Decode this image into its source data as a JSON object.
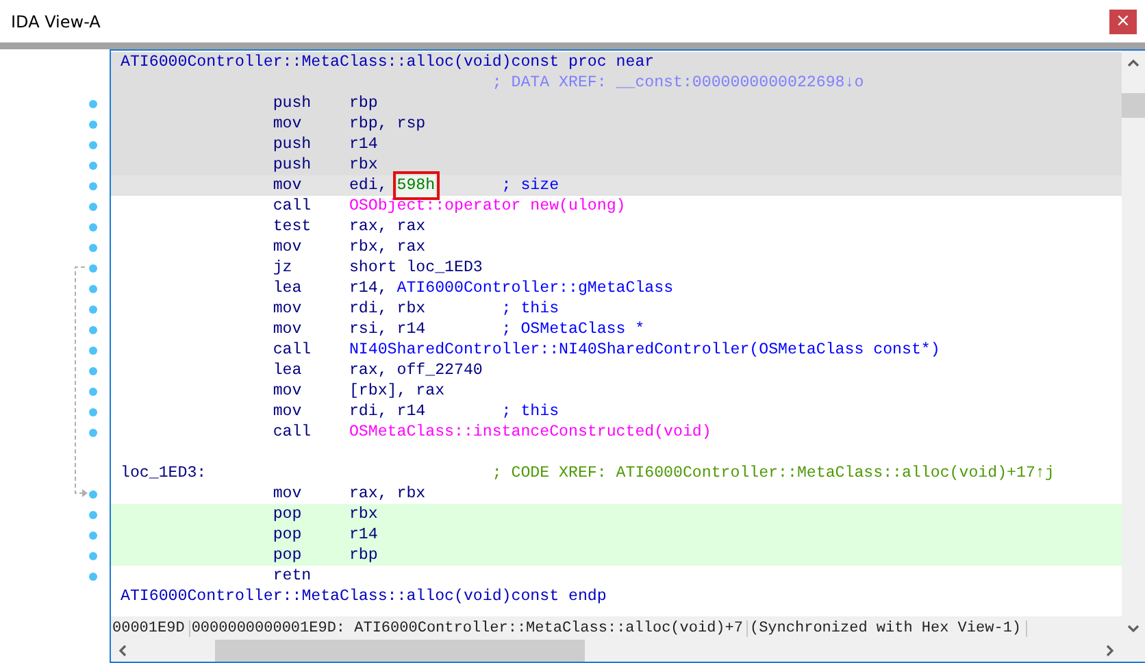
{
  "window": {
    "title": "IDA View-A",
    "close": "×"
  },
  "listing": [
    {
      "kind": "proc",
      "shaded": true,
      "selected": false,
      "traced": false,
      "text": "ATI6000Controller::MetaClass::alloc(void)const proc near"
    },
    {
      "kind": "data_xref",
      "shaded": true,
      "selected": false,
      "traced": false,
      "text": "; DATA XREF: __const:0000000000022698↓o"
    },
    {
      "kind": "instr",
      "shaded": true,
      "selected": false,
      "traced": false,
      "mnemonic": "push",
      "operands": [
        {
          "text": "rbp",
          "kind": "reg"
        }
      ]
    },
    {
      "kind": "instr",
      "shaded": true,
      "selected": false,
      "traced": false,
      "mnemonic": "mov",
      "operands": [
        {
          "text": "rbp, rsp",
          "kind": "reg"
        }
      ]
    },
    {
      "kind": "instr",
      "shaded": true,
      "selected": false,
      "traced": false,
      "mnemonic": "push",
      "operands": [
        {
          "text": "r14",
          "kind": "reg"
        }
      ]
    },
    {
      "kind": "instr",
      "shaded": true,
      "selected": false,
      "traced": false,
      "mnemonic": "push",
      "operands": [
        {
          "text": "rbx",
          "kind": "reg"
        }
      ]
    },
    {
      "kind": "instr",
      "shaded": false,
      "selected": true,
      "traced": false,
      "mnemonic": "mov",
      "operands": [
        {
          "text": "edi, ",
          "kind": "reg",
          "boxed": false
        },
        {
          "text": "598h",
          "kind": "number",
          "boxed": true
        }
      ],
      "comment": "; size"
    },
    {
      "kind": "instr",
      "shaded": false,
      "selected": false,
      "traced": false,
      "mnemonic": "call",
      "operands": [
        {
          "text": "OSObject::operator new(ulong)",
          "kind": "import"
        }
      ]
    },
    {
      "kind": "instr",
      "shaded": false,
      "selected": false,
      "traced": false,
      "mnemonic": "test",
      "operands": [
        {
          "text": "rax, rax",
          "kind": "reg"
        }
      ]
    },
    {
      "kind": "instr",
      "shaded": false,
      "selected": false,
      "traced": false,
      "mnemonic": "mov",
      "operands": [
        {
          "text": "rbx, rax",
          "kind": "reg"
        }
      ]
    },
    {
      "kind": "instr",
      "shaded": false,
      "selected": false,
      "traced": false,
      "mnemonic": "jz",
      "operands": [
        {
          "text": "short loc_1ED3",
          "kind": "reg"
        }
      ]
    },
    {
      "kind": "instr",
      "shaded": false,
      "selected": false,
      "traced": false,
      "mnemonic": "lea",
      "operands": [
        {
          "text": "r14, ",
          "kind": "reg"
        },
        {
          "text": "ATI6000Controller::gMetaClass",
          "kind": "name"
        }
      ]
    },
    {
      "kind": "instr",
      "shaded": false,
      "selected": false,
      "traced": false,
      "mnemonic": "mov",
      "operands": [
        {
          "text": "rdi, rbx",
          "kind": "reg"
        }
      ],
      "comment": "; this"
    },
    {
      "kind": "instr",
      "shaded": false,
      "selected": false,
      "traced": false,
      "mnemonic": "mov",
      "operands": [
        {
          "text": "rsi, r14",
          "kind": "reg"
        }
      ],
      "comment": "; OSMetaClass *"
    },
    {
      "kind": "instr",
      "shaded": false,
      "selected": false,
      "traced": false,
      "mnemonic": "call",
      "operands": [
        {
          "text": "NI40SharedController::NI40SharedController(OSMetaClass const*)",
          "kind": "name"
        }
      ]
    },
    {
      "kind": "instr",
      "shaded": false,
      "selected": false,
      "traced": false,
      "mnemonic": "lea",
      "operands": [
        {
          "text": "rax, off_22740",
          "kind": "reg"
        }
      ]
    },
    {
      "kind": "instr",
      "shaded": false,
      "selected": false,
      "traced": false,
      "mnemonic": "mov",
      "operands": [
        {
          "text": "[rbx], rax",
          "kind": "reg"
        }
      ]
    },
    {
      "kind": "instr",
      "shaded": false,
      "selected": false,
      "traced": false,
      "mnemonic": "mov",
      "operands": [
        {
          "text": "rdi, r14",
          "kind": "reg"
        }
      ],
      "comment": "; this"
    },
    {
      "kind": "instr",
      "shaded": false,
      "selected": false,
      "traced": false,
      "mnemonic": "call",
      "operands": [
        {
          "text": "OSMetaClass::instanceConstructed(void)",
          "kind": "import"
        }
      ]
    },
    {
      "kind": "blank",
      "shaded": false,
      "selected": false,
      "traced": false
    },
    {
      "kind": "label",
      "shaded": false,
      "selected": false,
      "traced": false,
      "text": "loc_1ED3:",
      "comment": "; CODE XREF: ATI6000Controller::MetaClass::alloc(void)+17↑j"
    },
    {
      "kind": "instr",
      "shaded": false,
      "selected": false,
      "traced": false,
      "mnemonic": "mov",
      "operands": [
        {
          "text": "rax, rbx",
          "kind": "reg"
        }
      ]
    },
    {
      "kind": "instr",
      "shaded": false,
      "selected": false,
      "traced": true,
      "mnemonic": "pop",
      "operands": [
        {
          "text": "rbx",
          "kind": "reg"
        }
      ]
    },
    {
      "kind": "instr",
      "shaded": false,
      "selected": false,
      "traced": true,
      "mnemonic": "pop",
      "operands": [
        {
          "text": "r14",
          "kind": "reg"
        }
      ]
    },
    {
      "kind": "instr",
      "shaded": false,
      "selected": false,
      "traced": true,
      "mnemonic": "pop",
      "operands": [
        {
          "text": "rbp",
          "kind": "reg"
        }
      ]
    },
    {
      "kind": "instr",
      "shaded": false,
      "selected": false,
      "traced": false,
      "mnemonic": "retn"
    },
    {
      "kind": "endp",
      "shaded": false,
      "selected": false,
      "traced": false,
      "text": "ATI6000Controller::MetaClass::alloc(void)const endp"
    }
  ],
  "status_bar": [
    "00001E9D",
    "0000000000001E9D: ATI6000Controller::MetaClass::alloc(void)+7",
    "(Synchronized with Hex View-1)"
  ]
}
